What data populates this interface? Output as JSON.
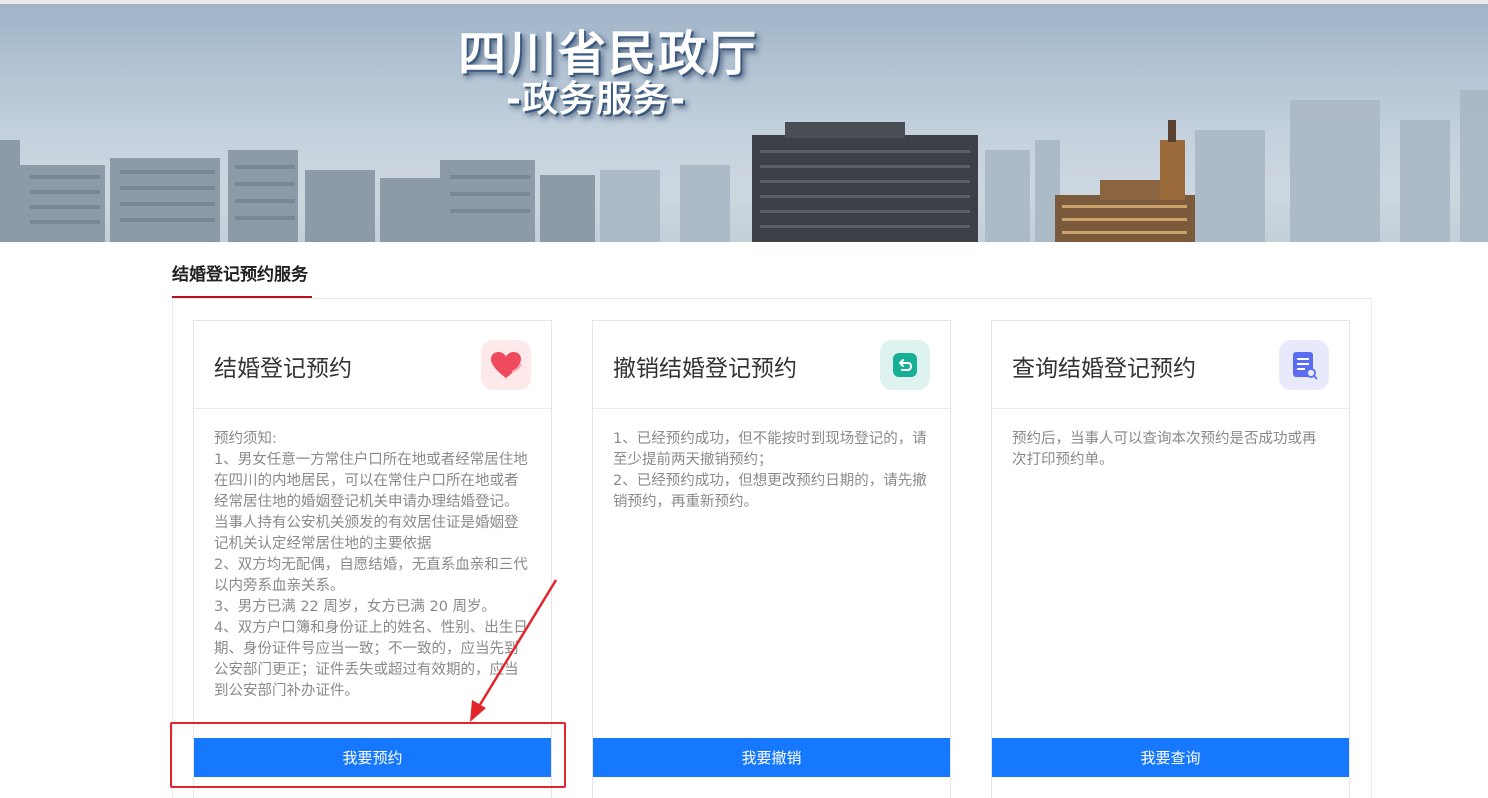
{
  "banner": {
    "title": "四川省民政厅",
    "subtitle": "-政务服务-"
  },
  "section": {
    "title": "结婚登记预约服务"
  },
  "cards": [
    {
      "title": "结婚登记预约",
      "icon": "heart-icon",
      "body": "预约须知:\n1、男女任意一方常住户口所在地或者经常居住地在四川的内地居民，可以在常住户口所在地或者经常居住地的婚姻登记机关申请办理结婚登记。当事人持有公安机关颁发的有效居住证是婚姻登记机关认定经常居住地的主要依据\n2、双方均无配偶，自愿结婚，无直系血亲和三代以内旁系血亲关系。\n3、男方已满 22 周岁，女方已满 20 周岁。\n4、双方户口簿和身份证上的姓名、性别、出生日期、身份证件号应当一致；不一致的，应当先到公安部门更正；证件丢失或超过有效期的，应当到公安部门补办证件。",
      "button": "我要预约"
    },
    {
      "title": "撤销结婚登记预约",
      "icon": "undo-icon",
      "body": "1、已经预约成功，但不能按时到现场登记的，请至少提前两天撤销预约；\n2、已经预约成功，但想更改预约日期的，请先撤销预约，再重新预约。",
      "button": "我要撤销"
    },
    {
      "title": "查询结婚登记预约",
      "icon": "document-search-icon",
      "body": "预约后，当事人可以查询本次预约是否成功或再次打印预约单。",
      "button": "我要查询"
    }
  ],
  "colors": {
    "primary_button": "#1677ff",
    "accent_underline": "#b5161c",
    "annotation": "#e3242b"
  }
}
